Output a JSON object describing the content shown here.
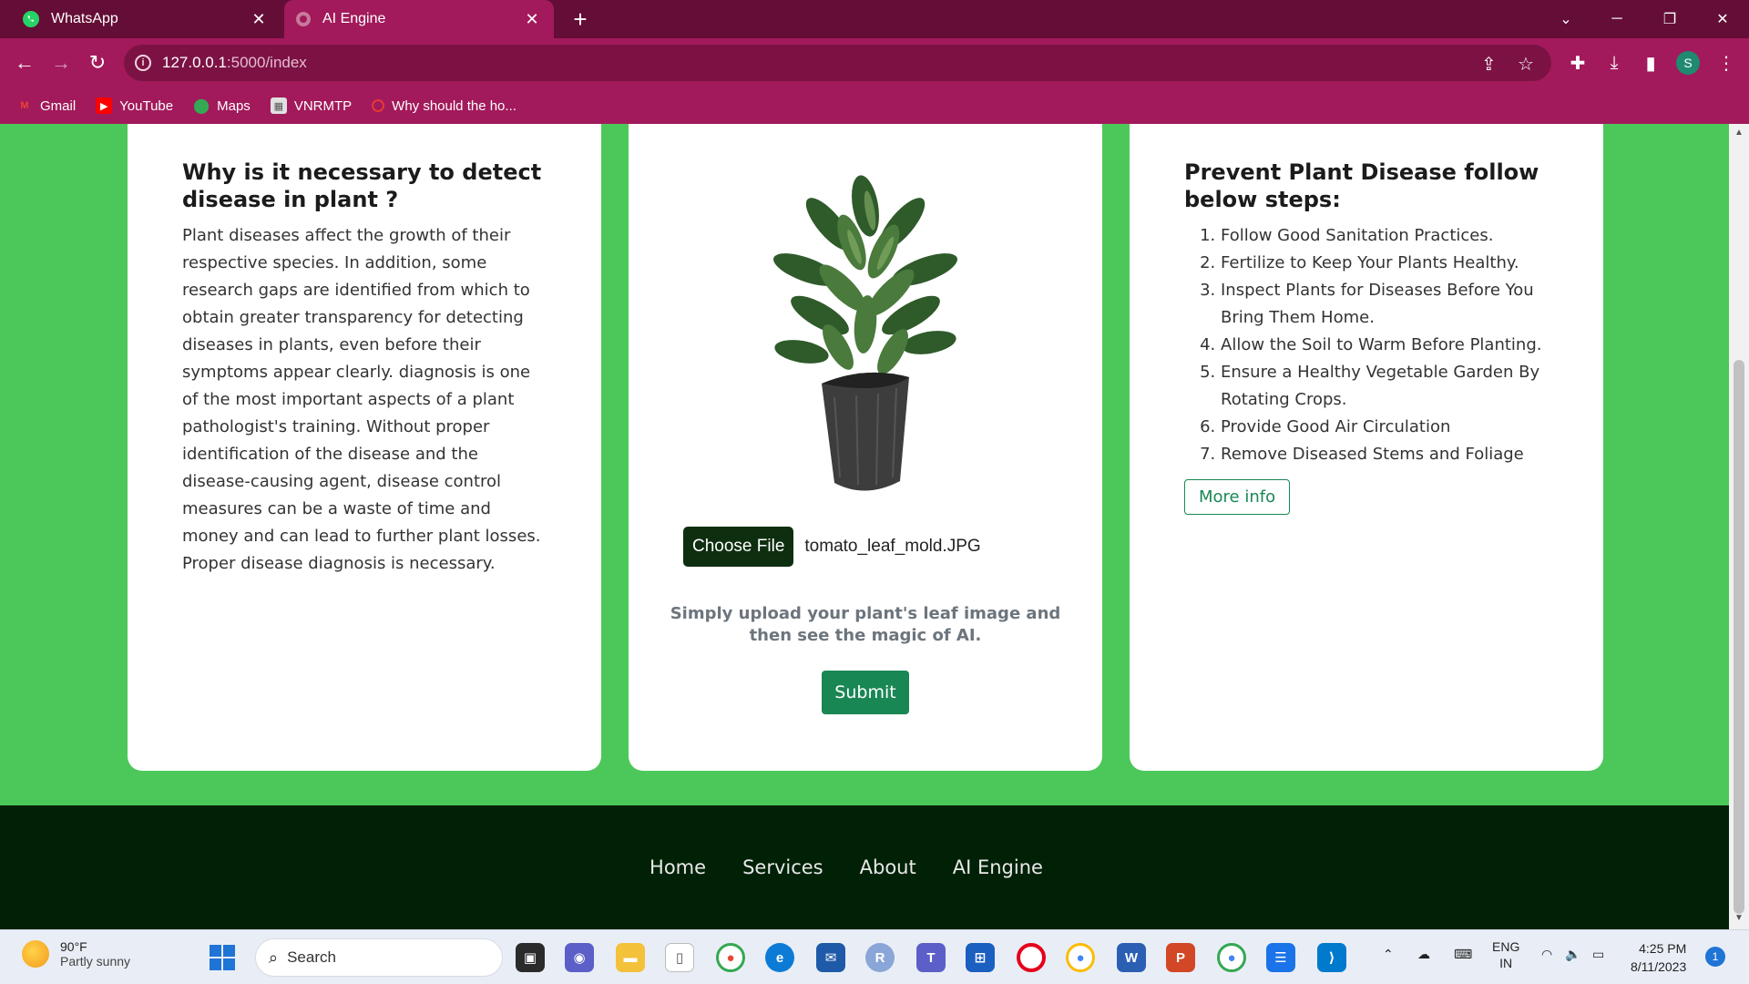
{
  "browser": {
    "tabs": [
      {
        "title": "WhatsApp",
        "icon": "whatsapp-icon"
      },
      {
        "title": "AI Engine",
        "icon": "globe-icon"
      }
    ],
    "url_host": "127.0.0.1",
    "url_path": ":5000/index",
    "profile_initial": "S",
    "bookmarks": [
      {
        "label": "Gmail",
        "icon": "gmail-icon"
      },
      {
        "label": "YouTube",
        "icon": "youtube-icon"
      },
      {
        "label": "Maps",
        "icon": "maps-icon"
      },
      {
        "label": "VNRMTP",
        "icon": "vnrmtp-icon"
      },
      {
        "label": "Why should the ho...",
        "icon": "opera-icon"
      }
    ]
  },
  "left_card": {
    "heading": "Why is it necessary to detect disease in plant ?",
    "body": "Plant diseases affect the growth of their respective species. In addition, some research gaps are identified from which to obtain greater transparency for detecting diseases in plants, even before their symptoms appear clearly. diagnosis is one of the most important aspects of a plant pathologist's training. Without proper identification of the disease and the disease-causing agent, disease control measures can be a waste of time and money and can lead to further plant losses. Proper disease diagnosis is necessary."
  },
  "center_card": {
    "choose_file_label": "Choose File",
    "file_name": "tomato_leaf_mold.JPG",
    "hint": "Simply upload your plant's leaf image and then see the magic of AI.",
    "submit_label": "Submit"
  },
  "right_card": {
    "heading": "Prevent Plant Disease follow below steps:",
    "steps": [
      "Follow Good Sanitation Practices.",
      "Fertilize to Keep Your Plants Healthy.",
      "Inspect Plants for Diseases Before You Bring Them Home.",
      "Allow the Soil to Warm Before Planting.",
      "Ensure a Healthy Vegetable Garden By Rotating Crops.",
      "Provide Good Air Circulation",
      "Remove Diseased Stems and Foliage"
    ],
    "more_info_label": "More info"
  },
  "footer": {
    "links": [
      "Home",
      "Services",
      "About",
      "AI Engine"
    ]
  },
  "taskbar": {
    "weather_temp": "90°F",
    "weather_desc": "Partly sunny",
    "search_placeholder": "Search",
    "lang_top": "ENG",
    "lang_bottom": "IN",
    "time": "4:25 PM",
    "date": "8/11/2023",
    "notification_count": "1"
  },
  "colors": {
    "tab_strip": "#640d36",
    "toolbar": "#a21a5b",
    "page_bg": "#4cc85a",
    "footer_bg": "#002106",
    "accent_green": "#198754"
  }
}
